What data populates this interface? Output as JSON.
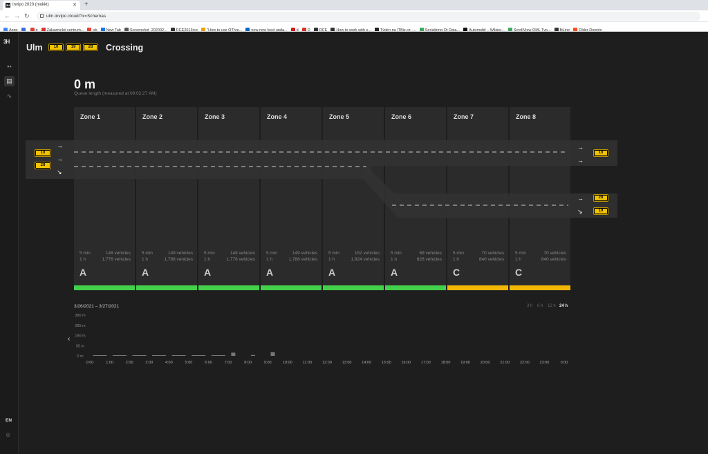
{
  "browser": {
    "tab_title": "Invipo 2020 (mokkt)",
    "tab_favicon": "3H",
    "url": "ulm.invipo.cloud/?x=Schemas",
    "bookmarks": [
      {
        "label": "Apps",
        "color": "#4285f4"
      },
      {
        "label": "",
        "color": "#3b6fd6"
      },
      {
        "label": "p",
        "color": "#db4437"
      },
      {
        "label": "Zákaznické centrum...",
        "color": "#d33"
      },
      {
        "label": "ob",
        "color": "#ea4335"
      },
      {
        "label": "New Tab",
        "color": "#1a73e8"
      },
      {
        "label": "Screenshot_202002...",
        "color": "#555"
      },
      {
        "label": "RCE2013rce",
        "color": "#333"
      },
      {
        "label": "\"How to use QThre...",
        "color": "#e8a100"
      },
      {
        "label": "new new feed upda...",
        "color": "#0a66c2"
      },
      {
        "label": "d",
        "color": "#d21c1c"
      },
      {
        "label": "D",
        "color": "#d93025"
      },
      {
        "label": "RCE",
        "color": "#333"
      },
      {
        "label": "How to work with s...",
        "color": "#333"
      },
      {
        "label": "Týden na ITBiz.cz -...",
        "color": "#222"
      },
      {
        "label": "Serializing Qt Data...",
        "color": "#41a85f"
      },
      {
        "label": "Automobil – Wikipe...",
        "color": "#111"
      },
      {
        "label": "ScrollView QML Typ...",
        "color": "#41a85f"
      },
      {
        "label": "fitLine",
        "color": "#333"
      },
      {
        "label": "Older Downlo",
        "color": "#f25022"
      }
    ]
  },
  "header": {
    "city": "Ulm",
    "chips": [
      "10",
      "19",
      "28"
    ],
    "title": "Crossing"
  },
  "queue": {
    "value": "0 m",
    "caption": "Queue length (measured at 09:02:27 AM)"
  },
  "lanes": {
    "left_chips": [
      "10",
      "28"
    ],
    "right_chips": [
      "10",
      "28",
      "19"
    ]
  },
  "zones": [
    {
      "name": "Zone 1",
      "m5": "5 min",
      "v5": "148 vehicles",
      "h1": "1 h",
      "vh": "1,776 vehicles",
      "los": "A",
      "color": "#43d14b"
    },
    {
      "name": "Zone 2",
      "m5": "5 min",
      "v5": "149 vehicles",
      "h1": "1 h",
      "vh": "1,788 vehicles",
      "los": "A",
      "color": "#43d14b"
    },
    {
      "name": "Zone 3",
      "m5": "5 min",
      "v5": "148 vehicles",
      "h1": "1 h",
      "vh": "1,776 vehicles",
      "los": "A",
      "color": "#43d14b"
    },
    {
      "name": "Zone 4",
      "m5": "5 min",
      "v5": "149 vehicles",
      "h1": "1 h",
      "vh": "1,788 vehicles",
      "los": "A",
      "color": "#43d14b"
    },
    {
      "name": "Zone 5",
      "m5": "5 min",
      "v5": "152 vehicles",
      "h1": "1 h",
      "vh": "1,824 vehicles",
      "los": "A",
      "color": "#43d14b"
    },
    {
      "name": "Zone 6",
      "m5": "5 min",
      "v5": "69 vehicles",
      "h1": "1 h",
      "vh": "828 vehicles",
      "los": "A",
      "color": "#43d14b"
    },
    {
      "name": "Zone 7",
      "m5": "5 min",
      "v5": "70 vehicles",
      "h1": "1 h",
      "vh": "840 vehicles",
      "los": "C",
      "color": "#f2b705"
    },
    {
      "name": "Zone 8",
      "m5": "5 min",
      "v5": "70 vehicles",
      "h1": "1 h",
      "vh": "840 vehicles",
      "los": "C",
      "color": "#f2b705"
    }
  ],
  "history": {
    "range": "3/26/2021 – 3/27/2021",
    "toggles": [
      "3 h",
      "6 h",
      "12 h",
      "24 h"
    ],
    "active_toggle": "24 h"
  },
  "chart_data": {
    "type": "bar",
    "title": "",
    "xlabel": "",
    "ylabel": "",
    "y_ticks": [
      "380 m",
      "285 m",
      "190 m",
      "95 m",
      "0 m"
    ],
    "ylim": [
      0,
      380
    ],
    "categories": [
      "0:00",
      "1:00",
      "2:00",
      "3:00",
      "4:00",
      "5:00",
      "6:00",
      "7:00",
      "8:00",
      "9:00",
      "10:00",
      "11:00",
      "12:00",
      "13:00",
      "14:00",
      "15:00",
      "16:00",
      "17:00",
      "18:00",
      "19:00",
      "20:00",
      "21:00",
      "22:00",
      "23:00",
      "0:00"
    ],
    "values": [
      2,
      2,
      2,
      2,
      2,
      2,
      2,
      30,
      8,
      35,
      0,
      0,
      0,
      0,
      0,
      0,
      0,
      0,
      0,
      0,
      0,
      0,
      0,
      0,
      0
    ],
    "bar_color": "#777777",
    "grid": false
  },
  "sidebar": {
    "logo": "3H",
    "lang": "EN"
  }
}
